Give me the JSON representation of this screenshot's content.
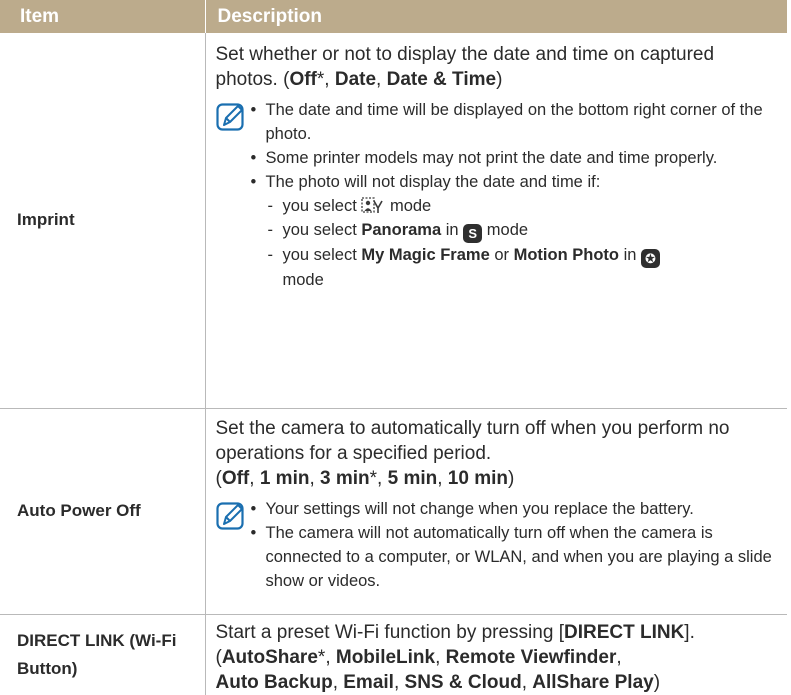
{
  "header": {
    "item": "Item",
    "description": "Description"
  },
  "rows": [
    {
      "item": "Imprint",
      "intro": "Set whether or not to display the date and time on captured photos. (",
      "options": {
        "off": "Off",
        "star": "*",
        "sep": ", ",
        "date": "Date",
        "date_time": "Date & Time",
        "close": ")"
      },
      "notes": [
        "The date and time will be displayed on the bottom right corner of the photo.",
        "Some printer models may not print the date and time properly.",
        "The photo will not display the date and time if:"
      ],
      "sub": {
        "s1_pre": "you select ",
        "s1_post": " mode",
        "s2_pre": "you select ",
        "s2_bold": "Panorama",
        "s2_mid": " in ",
        "s2_post": " mode",
        "s3_pre": "you select ",
        "s3_bold1": "My Magic Frame",
        "s3_mid": " or ",
        "s3_bold2": "Motion Photo",
        "s3_in": " in ",
        "s3_post": " mode"
      },
      "icons": {
        "s2_mode": "smart-mode-icon",
        "s3_mode": "magic-plus-mode-icon",
        "s1_mode": "scene-mode-icon"
      }
    },
    {
      "item": "Auto Power Off",
      "intro": "Set the camera to automatically turn off when you perform no operations for a specified period.",
      "opts": {
        "open": "(",
        "off": "Off",
        "sep": ", ",
        "m1": "1 min",
        "m3": "3 min",
        "star": "*",
        "m5": "5 min",
        "m10": "10 min",
        "close": ")"
      },
      "notes": [
        "Your settings will not change when you replace the battery.",
        "The camera will not automatically turn off when the camera is connected to a computer, or WLAN, and when you are playing a slide show or videos."
      ]
    },
    {
      "item": "DIRECT LINK (Wi-Fi Button)",
      "intro_pre": "Start a preset Wi-Fi function by pressing [",
      "intro_bold": "DIRECT LINK",
      "intro_post": "].",
      "opts": {
        "open": "(",
        "autoshare": "AutoShare",
        "star": "*",
        "sep": ", ",
        "mobilelink": "MobileLink",
        "remote": "Remote Viewfinder",
        "backup": "Auto Backup",
        "email": "Email",
        "sns": "SNS & Cloud",
        "allshare": "AllShare Play",
        "close": ")"
      }
    }
  ],
  "colors": {
    "header_bg": "#bcab8c",
    "header_text": "#ffffff",
    "rule": "#b9b9b9",
    "note_icon": "#1a6fb0"
  }
}
